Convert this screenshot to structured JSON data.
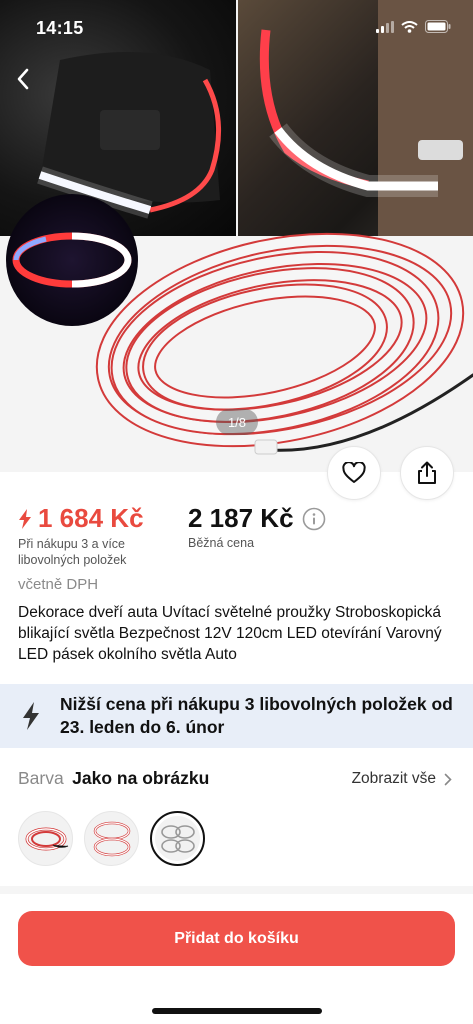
{
  "status_bar": {
    "time": "14:15"
  },
  "gallery": {
    "counter": "1/8"
  },
  "icons": {
    "back": "chevron-left-icon",
    "favorite": "heart-icon",
    "share": "share-icon",
    "flash": "lightning-icon",
    "info": "info-icon",
    "chevron": "chevron-right-icon"
  },
  "price": {
    "sale": "1 684 Kč",
    "sale_note": "Při nákupu 3 a více libovolných položek",
    "regular": "2 187 Kč",
    "regular_label": "Běžná cena",
    "vat": "včetně DPH"
  },
  "product": {
    "title": "Dekorace dveří auta Uvítací světelné proužky Stroboskopická blikající světla Bezpečnost 12V 120cm LED otevírání Varovný LED pásek okolního světla Auto"
  },
  "promo": {
    "text": "Nižší cena při nákupu 3 libovolných položek od 23. leden do 6. únor"
  },
  "variant": {
    "label": "Barva",
    "value": "Jako na obrázku",
    "show_all": "Zobrazit vše"
  },
  "cart": {
    "label": "Přidat do košíku"
  },
  "colors": {
    "accent": "#f0524a",
    "price_red": "#e94a3f",
    "promo_bg": "#e8eef8"
  }
}
